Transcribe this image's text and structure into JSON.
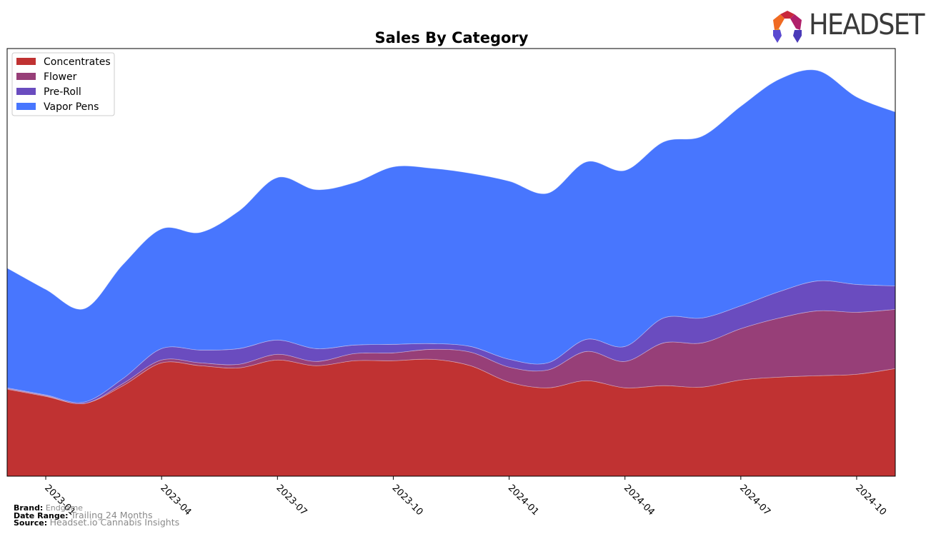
{
  "header": {
    "logo_text": "HEADSET",
    "logo_icon": "headset-logo-icon"
  },
  "chart_data": {
    "type": "area",
    "stacked": true,
    "smoothed": true,
    "title": "Sales By Category",
    "xlabel": "",
    "ylabel": "",
    "y_axis_visible": false,
    "grid": false,
    "legend_position": "top-left",
    "x": [
      "2022-12",
      "2023-01",
      "2023-02",
      "2023-03",
      "2023-04",
      "2023-05",
      "2023-06",
      "2023-07",
      "2023-08",
      "2023-09",
      "2023-10",
      "2023-11",
      "2023-12",
      "2024-01",
      "2024-02",
      "2024-03",
      "2024-04",
      "2024-05",
      "2024-06",
      "2024-07",
      "2024-08",
      "2024-09",
      "2024-10",
      "2024-11"
    ],
    "x_tick_labels": [
      "2023-01",
      "2023-04",
      "2023-07",
      "2023-10",
      "2024-01",
      "2024-04",
      "2024-07",
      "2024-10"
    ],
    "ylim": [
      0,
      600
    ],
    "series": [
      {
        "name": "Concentrates",
        "color": "#c03232",
        "values": [
          122,
          112,
          102,
          127,
          159,
          155,
          152,
          163,
          155,
          162,
          162,
          164,
          155,
          132,
          124,
          134,
          124,
          127,
          125,
          135,
          139,
          141,
          143,
          151
        ]
      },
      {
        "name": "Flower",
        "color": "#973f78",
        "values": [
          1,
          1,
          0,
          3,
          4,
          4,
          5,
          8,
          6,
          10,
          11,
          14,
          19,
          21,
          25,
          41,
          37,
          60,
          62,
          72,
          83,
          91,
          87,
          83
        ]
      },
      {
        "name": "Pre-Roll",
        "color": "#6a4cbf",
        "values": [
          1,
          1,
          2,
          7,
          16,
          18,
          22,
          20,
          18,
          12,
          12,
          8,
          8,
          11,
          10,
          17,
          21,
          35,
          35,
          32,
          37,
          42,
          39,
          33
        ]
      },
      {
        "name": "Vapor Pens",
        "color": "#4876fe",
        "values": [
          168,
          148,
          131,
          160,
          168,
          165,
          193,
          228,
          223,
          228,
          249,
          246,
          243,
          250,
          238,
          249,
          247,
          247,
          255,
          280,
          298,
          295,
          263,
          244
        ]
      }
    ]
  },
  "footer": {
    "brand_label": "Brand:",
    "brand_value": "Endgame",
    "date_range_label": "Date Range:",
    "date_range_value": "Trailing 24 Months",
    "source_label": "Source:",
    "source_value": "Headset.io Cannabis Insights"
  }
}
